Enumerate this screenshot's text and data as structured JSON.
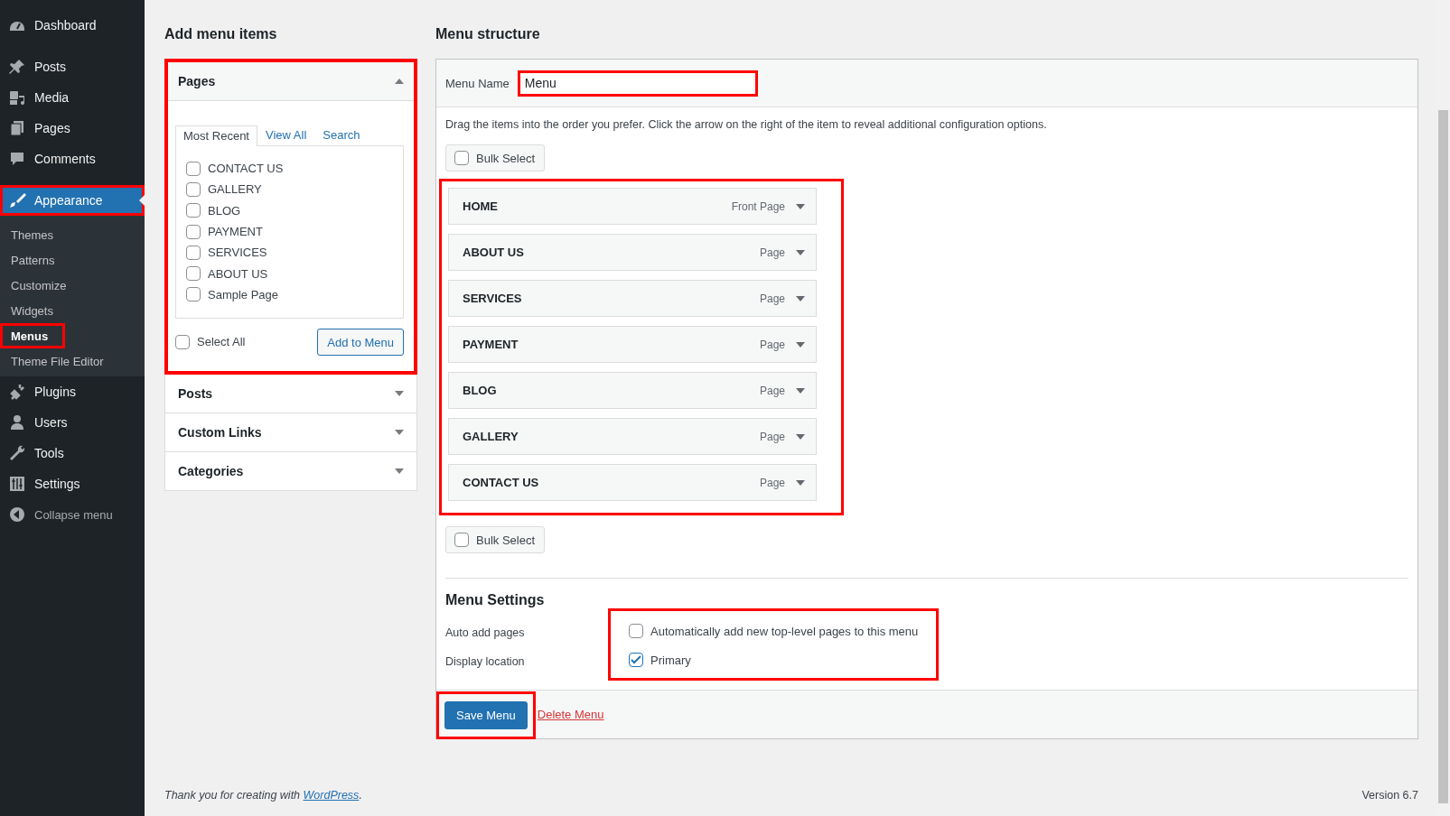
{
  "sidebar": {
    "items": [
      {
        "label": "Dashboard",
        "kind": "dashboard",
        "selected": false,
        "highlighted": false
      },
      {
        "label": "Posts",
        "kind": "pin",
        "selected": false,
        "highlighted": false
      },
      {
        "label": "Media",
        "kind": "media",
        "selected": false,
        "highlighted": false
      },
      {
        "label": "Pages",
        "kind": "pages",
        "selected": false,
        "highlighted": false
      },
      {
        "label": "Comments",
        "kind": "comment",
        "selected": false,
        "highlighted": false
      },
      {
        "label": "Appearance",
        "kind": "brush",
        "selected": true,
        "highlighted": true,
        "children": [
          {
            "label": "Themes",
            "selected": false,
            "highlighted": false
          },
          {
            "label": "Patterns",
            "selected": false,
            "highlighted": false
          },
          {
            "label": "Customize",
            "selected": false,
            "highlighted": false
          },
          {
            "label": "Widgets",
            "selected": false,
            "highlighted": false
          },
          {
            "label": "Menus",
            "selected": true,
            "highlighted": true
          },
          {
            "label": "Theme File Editor",
            "selected": false,
            "highlighted": false
          }
        ]
      },
      {
        "label": "Plugins",
        "kind": "plugin",
        "selected": false,
        "highlighted": false
      },
      {
        "label": "Users",
        "kind": "user",
        "selected": false,
        "highlighted": false
      },
      {
        "label": "Tools",
        "kind": "wrench",
        "selected": false,
        "highlighted": false
      },
      {
        "label": "Settings",
        "kind": "settings",
        "selected": false,
        "highlighted": false
      }
    ],
    "collapse": "Collapse menu"
  },
  "add_items": {
    "title": "Add menu items",
    "sections": [
      {
        "title": "Pages",
        "expanded": true,
        "highlighted": true,
        "tabs": [
          {
            "label": "Most Recent",
            "selected": true
          },
          {
            "label": "View All",
            "selected": false
          },
          {
            "label": "Search",
            "selected": false
          }
        ],
        "pages": [
          {
            "label": "CONTACT US",
            "checked": false
          },
          {
            "label": "GALLERY",
            "checked": false
          },
          {
            "label": "BLOG",
            "checked": false
          },
          {
            "label": "PAYMENT",
            "checked": false
          },
          {
            "label": "SERVICES",
            "checked": false
          },
          {
            "label": "ABOUT US",
            "checked": false
          },
          {
            "label": "Sample Page",
            "checked": false
          }
        ],
        "select_all": {
          "label": "Select All",
          "checked": false
        },
        "add_button": "Add to Menu"
      },
      {
        "title": "Posts",
        "expanded": false,
        "highlighted": false
      },
      {
        "title": "Custom Links",
        "expanded": false,
        "highlighted": false
      },
      {
        "title": "Categories",
        "expanded": false,
        "highlighted": false
      }
    ]
  },
  "menu_structure": {
    "title": "Menu structure",
    "menu_name_label": "Menu Name",
    "menu_name": {
      "value": "Menu",
      "highlighted": true
    },
    "instructions": "Drag the items into the order you prefer. Click the arrow on the right of the item to reveal additional configuration options.",
    "bulk_select_top": {
      "label": "Bulk Select",
      "checked": false
    },
    "items_highlighted": true,
    "items": [
      {
        "title": "HOME",
        "type": "Front Page"
      },
      {
        "title": "ABOUT US",
        "type": "Page"
      },
      {
        "title": "SERVICES",
        "type": "Page"
      },
      {
        "title": "PAYMENT",
        "type": "Page"
      },
      {
        "title": "BLOG",
        "type": "Page"
      },
      {
        "title": "GALLERY",
        "type": "Page"
      },
      {
        "title": "CONTACT US",
        "type": "Page"
      }
    ],
    "bulk_select_bottom": {
      "label": "Bulk Select",
      "checked": false
    },
    "settings": {
      "title": "Menu Settings",
      "highlighted": true,
      "rows": [
        {
          "label": "Auto add pages",
          "option": "Automatically add new top-level pages to this menu",
          "checked": false
        },
        {
          "label": "Display location",
          "option": "Primary",
          "checked": true
        }
      ]
    },
    "save_button": {
      "label": "Save Menu",
      "highlighted": true
    },
    "delete_link": "Delete Menu"
  },
  "footer": {
    "credit_prefix": "Thank you for creating with ",
    "credit_link": "WordPress",
    "credit_suffix": ".",
    "version": "Version 6.7"
  }
}
